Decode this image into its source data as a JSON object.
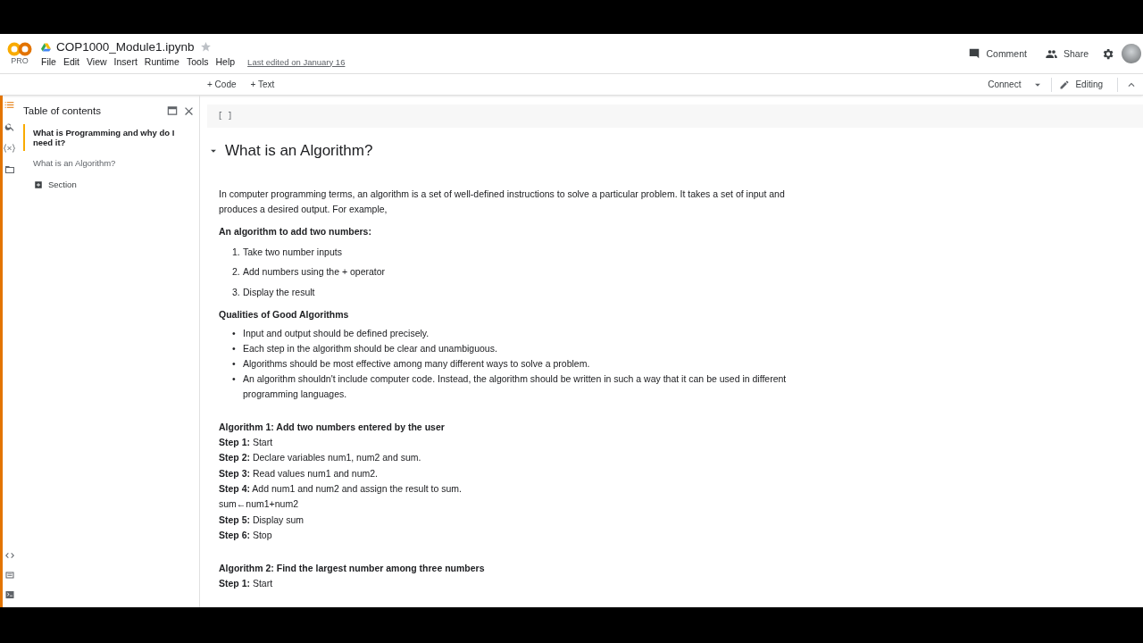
{
  "header": {
    "logo": "PRO",
    "title": "COP1000_Module1.ipynb",
    "menu": [
      "File",
      "Edit",
      "View",
      "Insert",
      "Runtime",
      "Tools",
      "Help"
    ],
    "last_edited": "Last edited on January 16",
    "comment": "Comment",
    "share": "Share"
  },
  "toolbar": {
    "add_code": "+ Code",
    "add_text": "+ Text",
    "connect": "Connect",
    "editing": "Editing"
  },
  "toc": {
    "title": "Table of contents",
    "items": [
      {
        "label": "What is Programming and why do I need it?",
        "selected": true
      },
      {
        "label": "What is an Algorithm?",
        "selected": false
      }
    ],
    "section_button": "Section"
  },
  "cell": {
    "brackets": "[ ]"
  },
  "heading": "What is an Algorithm?",
  "blocks": [
    {
      "kind": "para",
      "text": "In computer programming terms, an algorithm is a set of well-defined instructions to solve a particular problem. It takes a set of input and produces a desired output. For example,"
    },
    {
      "kind": "title",
      "text": "An algorithm to add two numbers:"
    },
    {
      "kind": "ordered",
      "items": [
        {
          "marker": "1.",
          "text": "Take two number inputs"
        },
        {
          "marker": "2.",
          "text": "Add numbers using the + operator"
        },
        {
          "marker": "3.",
          "text": "Display the result"
        }
      ]
    },
    {
      "kind": "title",
      "text": "Qualities of Good Algorithms"
    },
    {
      "kind": "bullets",
      "items": [
        {
          "marker": "•",
          "text": "Input and output should be defined precisely."
        },
        {
          "marker": "•",
          "text": "Each step in the algorithm should be clear and unambiguous."
        },
        {
          "marker": "•",
          "text": "Algorithms should be most effective among many different ways to solve a problem."
        },
        {
          "marker": "•",
          "text": "An algorithm shouldn't include computer code. Instead, the algorithm should be written in such a way that it can be used in different programming languages."
        }
      ]
    },
    {
      "kind": "steps",
      "title": "Algorithm 1: Add two numbers entered by the user",
      "lines": [
        "**Step 1:** Start",
        "**Step 2:** Declare variables num1, num2 and sum.",
        "**Step 3:** Read values num1 and num2.",
        "**Step 4:** Add num1 and num2 and assign the result to sum.",
        "sum←num1+num2",
        "**Step 5:** Display sum",
        "**Step 6:** Stop"
      ]
    },
    {
      "kind": "steps",
      "title": "Algorithm 2: Find the largest number among three numbers",
      "lines": [
        "**Step 1:** Start"
      ]
    }
  ]
}
